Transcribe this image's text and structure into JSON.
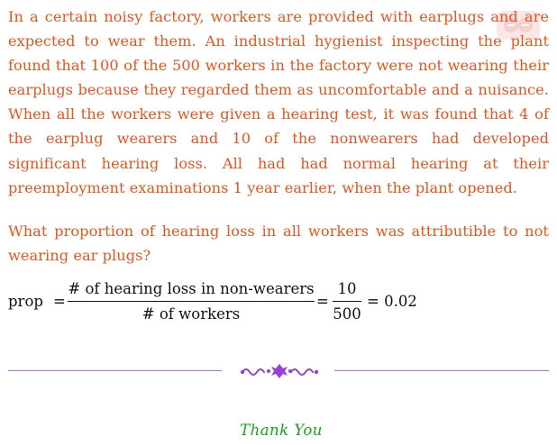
{
  "problem": {
    "paragraph": "In a certain noisy factory, workers are provided with earplugs and are expected to wear them. An industrial hygienist inspecting the plant found that 100 of the 500 workers in the factory were not wearing their earplugs because they regarded them as uncomfortable and a nuisance. When all the workers were given a hearing test, it was found that 4 of the earplug wearers and 10 of the nonwearers had developed significant hearing loss. All had had normal hearing at their preemployment examinations 1 year earlier, when the plant opened.",
    "question": "What proportion of hearing loss in all workers was attributible to not wearing ear plugs?"
  },
  "equation": {
    "lhs": "prop",
    "equals": "=",
    "fraction_numerator": "# of hearing loss in non-wearers",
    "fraction_denominator": "# of workers",
    "value_numerator": "10",
    "value_denominator": "500",
    "result": "= 0.02"
  },
  "footer": {
    "thanks": "Thank You"
  },
  "colors": {
    "text_accent": "#e8541c",
    "divider": "#b46be6",
    "thanks": "#12a812"
  }
}
